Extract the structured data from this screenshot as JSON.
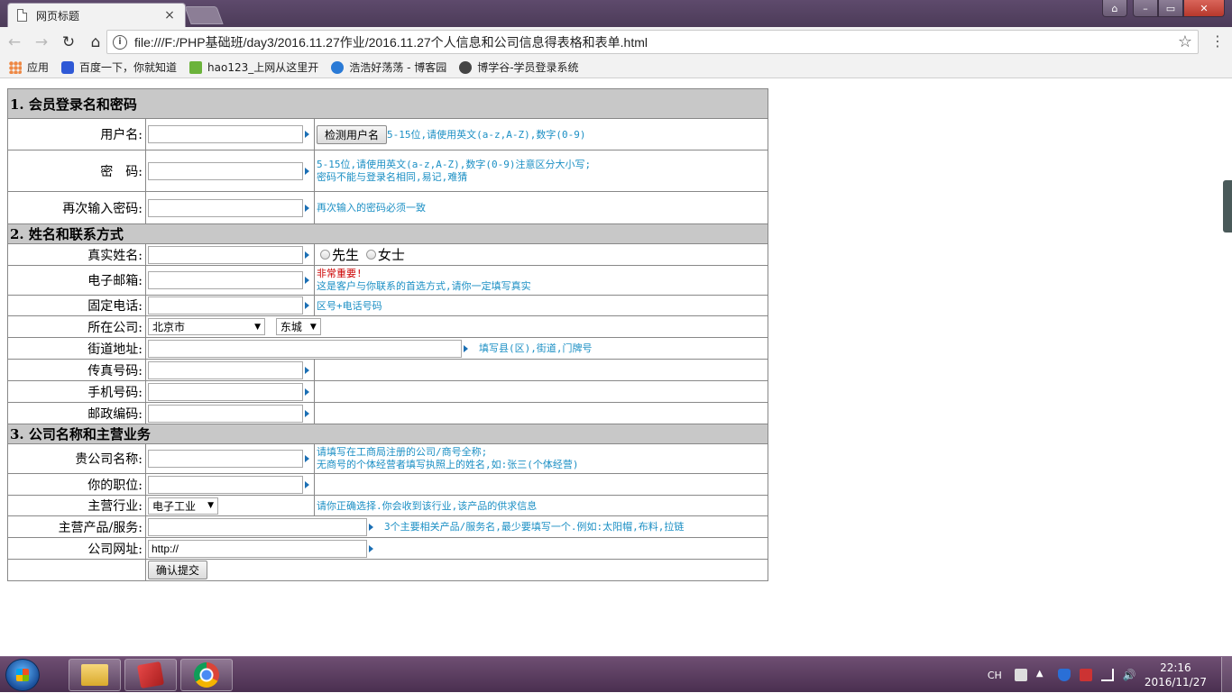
{
  "browser": {
    "tab_title": "网页标题",
    "tab_close": "×",
    "url": "file:///F:/PHP基础班/day3/2016.11.27作业/2016.11.27个人信息和公司信息得表格和表单.html",
    "nav": {
      "back": "←",
      "forward": "→",
      "reload": "↻",
      "home": "⌂"
    },
    "info_glyph": "i",
    "star_glyph": "☆",
    "menu_glyph": "⋮",
    "window": {
      "minimize": "–",
      "maximize": "▭",
      "close": "✕",
      "user": "⌂"
    },
    "bookmarks": [
      {
        "label": "应用",
        "icon": "apps-icon"
      },
      {
        "label": "百度一下，你就知道",
        "icon": "baidu-icon"
      },
      {
        "label": "hao123_上网从这里开",
        "icon": "hao123-icon"
      },
      {
        "label": "浩浩好荡荡 - 博客园",
        "icon": "cnblogs-icon"
      },
      {
        "label": "博学谷-学员登录系统",
        "icon": "boxuegu-icon"
      }
    ]
  },
  "form": {
    "sections": [
      {
        "title": "1. 会员登录名和密码"
      },
      {
        "title": "2. 姓名和联系方式"
      },
      {
        "title": "3. 公司名称和主营业务"
      }
    ],
    "login": {
      "username_label": "用户名:",
      "check_button": "检测用户名",
      "username_hint": "5-15位,请使用英文(a-z,A-Z),数字(0-9)",
      "password_label": "密　码:",
      "password_hint_1": "5-15位,请使用英文(a-z,A-Z),数字(0-9)注意区分大小写;",
      "password_hint_2": "密码不能与登录名相同,易记,难猜",
      "repeat_label": "再次输入密码:",
      "repeat_hint": "再次输入的密码必须一致"
    },
    "contact": {
      "realname_label": "真实姓名:",
      "gender_options": [
        "先生",
        "女士"
      ],
      "email_label": "电子邮箱:",
      "email_hint_important": "非常重要!",
      "email_hint": "这是客户与你联系的首选方式,请你一定填写真实",
      "phone_label": "固定电话:",
      "phone_hint": "区号+电话号码",
      "company_loc_label": "所在公司:",
      "city_selected": "北京市",
      "district_selected": "东城",
      "street_label": "街道地址:",
      "street_hint": "填写县(区),街道,门牌号",
      "fax_label": "传真号码:",
      "mobile_label": "手机号码:",
      "zip_label": "邮政编码:"
    },
    "business": {
      "company_label": "贵公司名称:",
      "company_hint_1": "请填写在工商局注册的公司/商号全称;",
      "company_hint_2": "无商号的个体经营者填写执照上的姓名,如:张三(个体经营)",
      "position_label": "你的职位:",
      "industry_label": "主营行业:",
      "industry_selected": "电子工业",
      "industry_hint": "请你正确选择.你会收到该行业,该产品的供求信息",
      "product_label": "主营产品/服务:",
      "product_hint": "3个主要相关产品/服务名,最少要填写一个.例如:太阳帽,布料,拉链",
      "website_label": "公司网址:",
      "website_value": "http://",
      "submit_button": "确认提交"
    }
  },
  "taskbar": {
    "lang": "CH",
    "time": "22:16",
    "date": "2016/11/27"
  }
}
